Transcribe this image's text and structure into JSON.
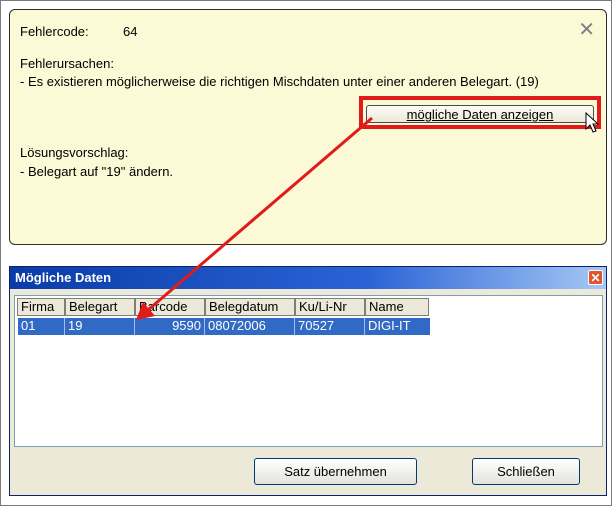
{
  "error_panel": {
    "code_label": "Fehlercode:",
    "code_value": "64",
    "causes_label": "Fehlerursachen:",
    "causes_text": "- Es existieren möglicherweise die richtigen Mischdaten unter einer anderen Belegart. (19)",
    "show_button_label": "mögliche Daten anzeigen",
    "solution_label": "Lösungsvorschlag:",
    "solution_text": "- Belegart auf \"19\" ändern.",
    "close_icon": "✕"
  },
  "dialog": {
    "title": "Mögliche Daten",
    "close_icon": "✕",
    "columns": [
      "Firma",
      "Belegart",
      "Barcode",
      "Belegdatum",
      "Ku/Li-Nr",
      "Name"
    ],
    "rows": [
      [
        "01",
        "19",
        "9590",
        "08072006",
        "70527",
        "DIGI-IT"
      ]
    ],
    "accept_button": "Satz übernehmen",
    "close_button": "Schließen"
  },
  "colors": {
    "panel_bg": "#fbf9d6",
    "highlight": "#e11a1a",
    "selection": "#316ac5",
    "titlebar": "#0a3ca8"
  }
}
